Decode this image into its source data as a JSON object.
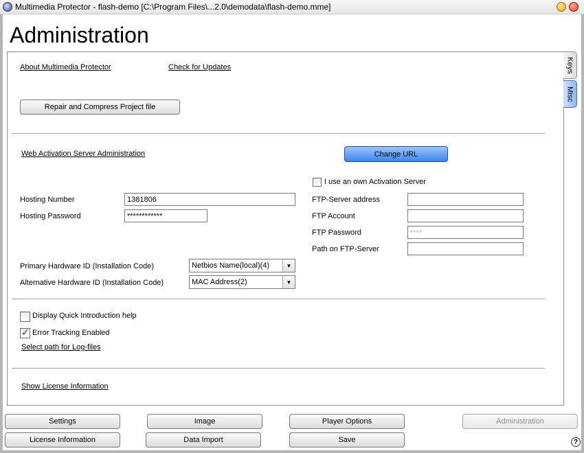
{
  "window": {
    "title": "Multimedia Protector - flash-demo [C:\\Program Files\\...2.0\\demodata\\flash-demo.mme]"
  },
  "page": {
    "title": "Administration"
  },
  "top_links": {
    "about": "About Multimedia Protector",
    "updates": "Check for Updates"
  },
  "repair_button": "Repair and Compress Project file",
  "web_activation": {
    "heading": "Web Activation Server Administration",
    "change_url_button": "Change URL",
    "own_server_label": "I use an own Activation Server",
    "own_server_checked": false,
    "hosting_number_label": "Hosting Number",
    "hosting_number_value": "1381806",
    "hosting_password_label": "Hosting Password",
    "hosting_password_value": "************",
    "ftp_server_label": "FTP-Server address",
    "ftp_server_value": "",
    "ftp_account_label": "FTP Account",
    "ftp_account_value": "",
    "ftp_password_label": "FTP Password",
    "ftp_password_value": "****",
    "ftp_path_label": "Path on FTP-Server",
    "ftp_path_value": ""
  },
  "hardware": {
    "primary_label": "Primary Hardware ID (Installation Code)",
    "primary_value": "Netbios Name(local)(4)",
    "alternative_label": "Alternative Hardware ID (Installation Code)",
    "alternative_value": "MAC Address(2)"
  },
  "options": {
    "quick_intro_label": "Display Quick Introduction help",
    "quick_intro_checked": false,
    "error_tracking_label": "Error Tracking Enabled",
    "error_tracking_checked": true,
    "log_path_link": "Select path for Log-files"
  },
  "license_link": "Show License Information",
  "side_tabs": [
    {
      "label": "Keys",
      "active": false
    },
    {
      "label": "Misc",
      "active": true
    }
  ],
  "bottom_nav": {
    "settings": "Settings",
    "image": "Image",
    "player_options": "Player Options",
    "administration": "Administration",
    "license_information": "License Information",
    "data_import": "Data Import",
    "save": "Save"
  },
  "help_icon": "?",
  "colors": {
    "accent_blue": "#3d86ef",
    "check_mark": "#1b3ea8"
  }
}
